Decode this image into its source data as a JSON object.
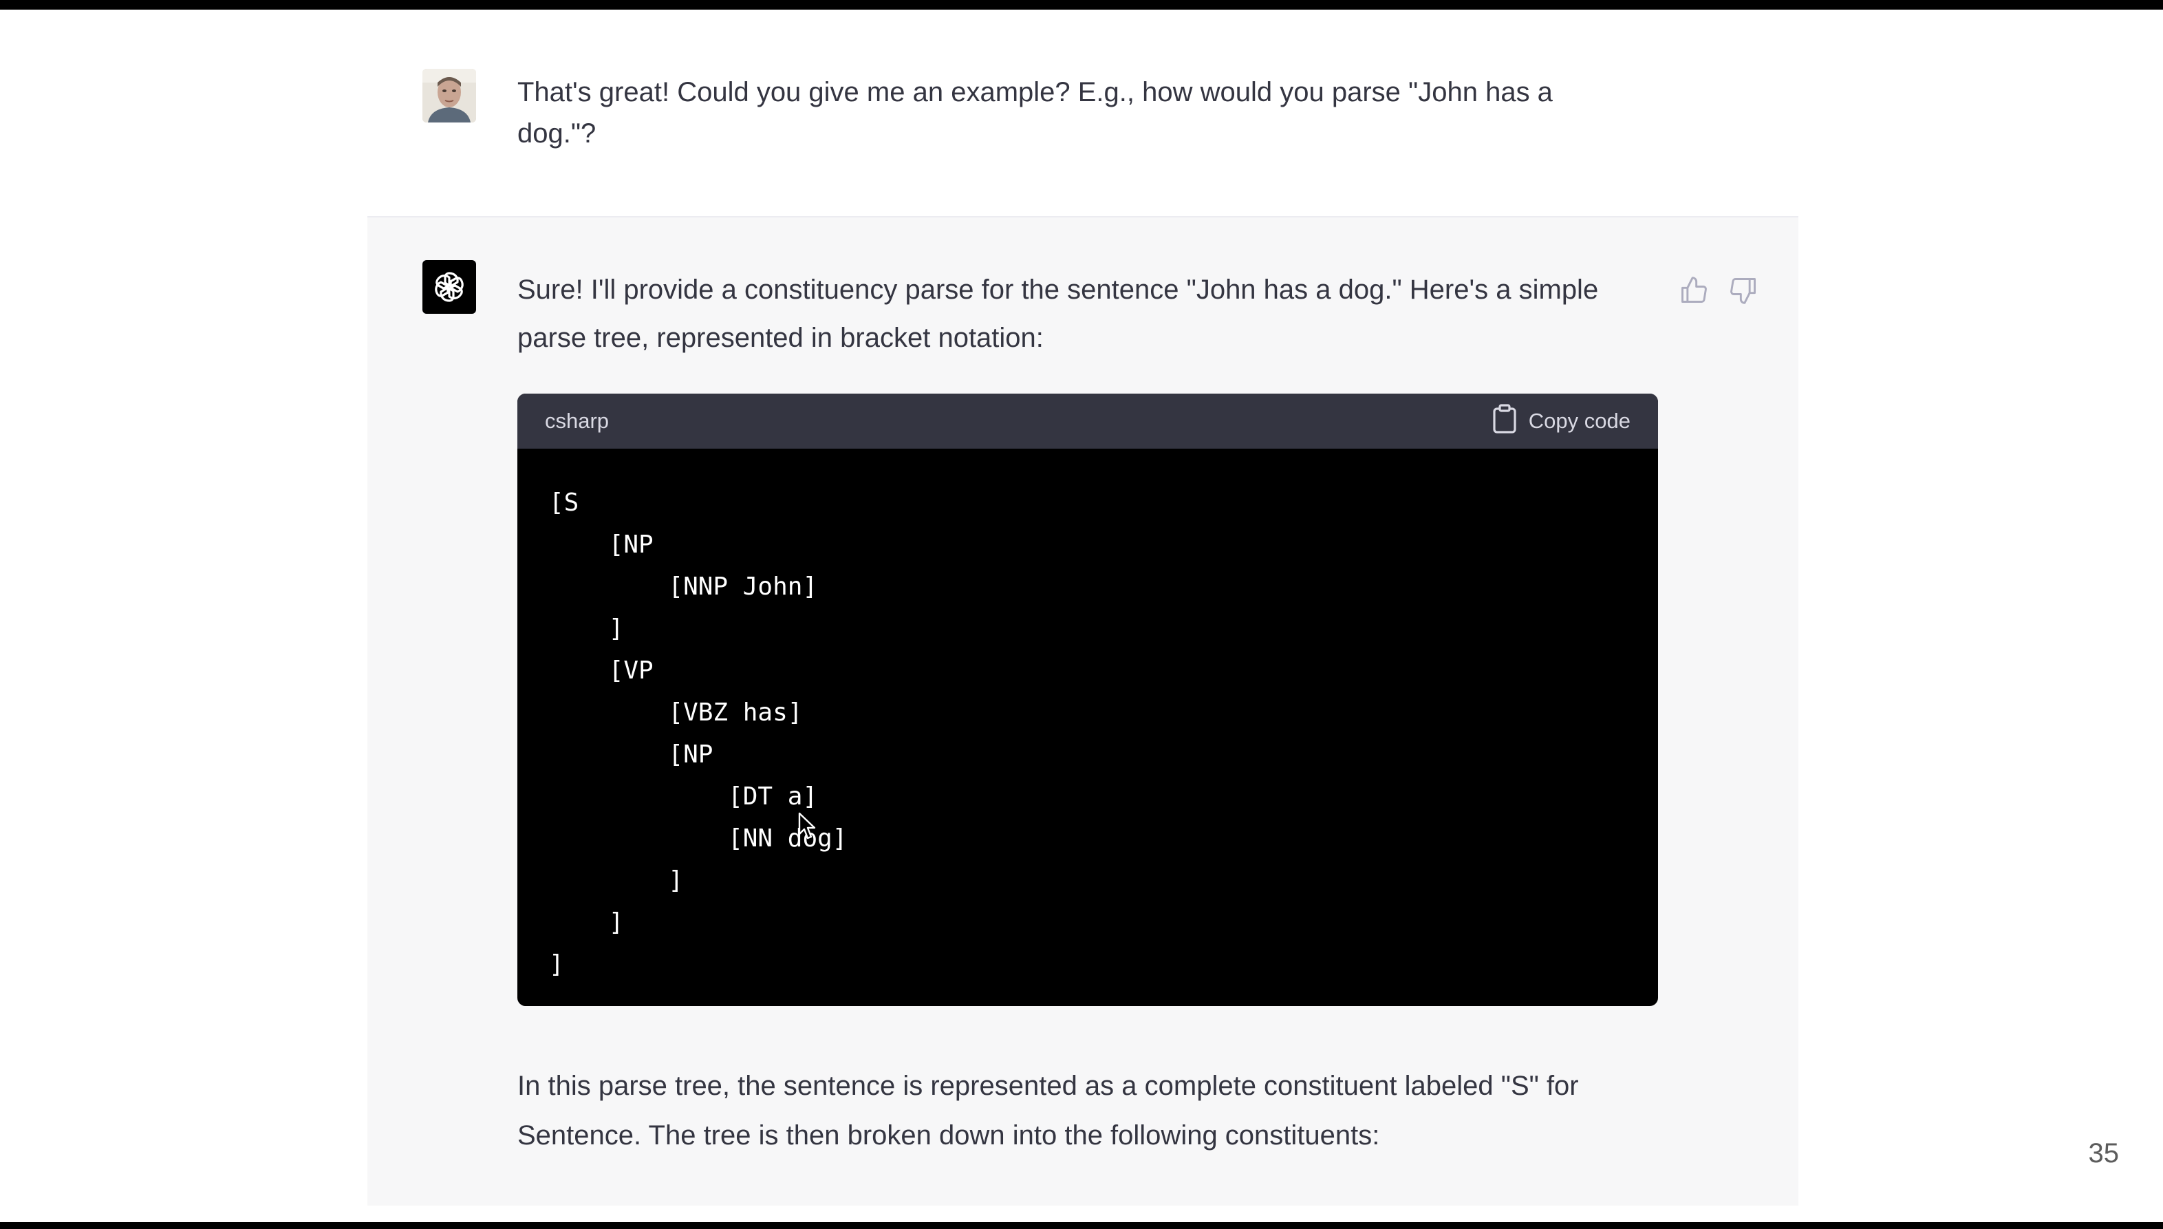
{
  "user_message": {
    "text": "That's great! Could you give me an example? E.g., how would you parse \"John has a dog.\"?"
  },
  "assistant_message": {
    "intro": "Sure! I'll provide a constituency parse for the sentence \"John has a dog.\" Here's a simple parse tree, represented in bracket notation:",
    "code_block": {
      "language": "csharp",
      "copy_label": "Copy code",
      "code": "[S\n    [NP\n        [NNP John]\n    ]\n    [VP\n        [VBZ has]\n        [NP\n            [DT a]\n            [NN dog]\n        ]\n    ]\n]"
    },
    "after": "In this parse tree, the sentence is represented as a complete constituent labeled \"S\" for Sentence. The tree is then broken down into the following constituents:"
  },
  "slide_number": "35",
  "colors": {
    "assistant_bg": "#f7f7f8",
    "code_header_bg": "#343541",
    "code_bg": "#000000",
    "text": "#343541"
  },
  "icons": {
    "thumbs_up": "thumbs-up-icon",
    "thumbs_down": "thumbs-down-icon",
    "copy": "clipboard-icon",
    "bot_logo": "openai-logo-icon"
  }
}
